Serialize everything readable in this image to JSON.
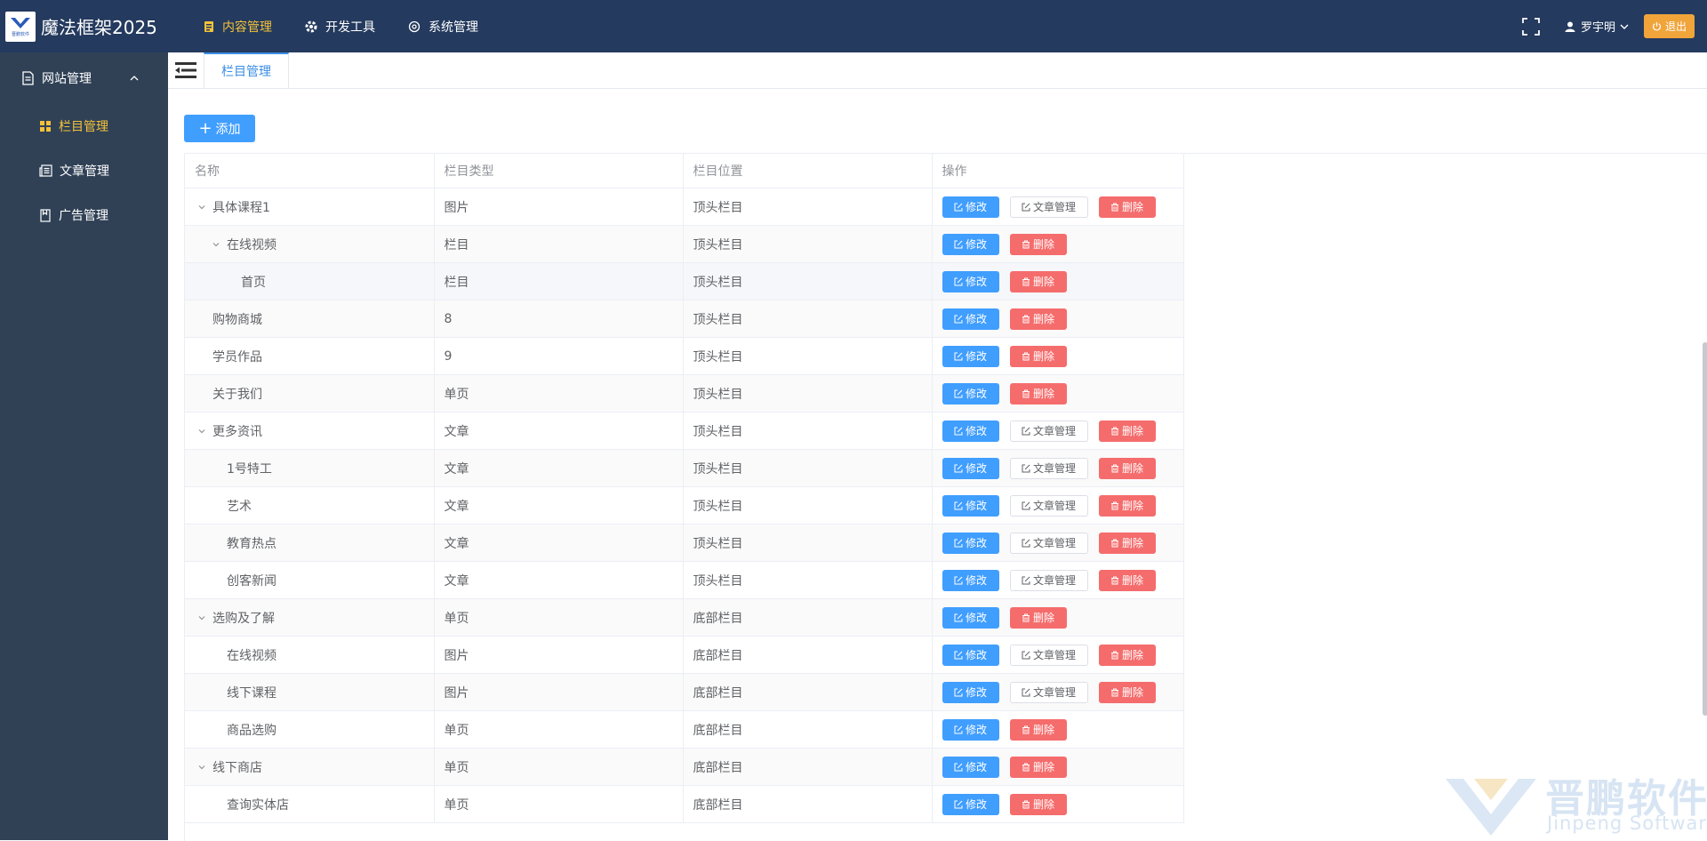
{
  "header": {
    "logo_text": "晋鹏软件",
    "title": "魔法框架2025",
    "nav": [
      {
        "label": "内容管理",
        "active": true
      },
      {
        "label": "开发工具",
        "active": false
      },
      {
        "label": "系统管理",
        "active": false
      }
    ],
    "user": "罗宇明",
    "logout": "退出"
  },
  "sidebar": {
    "group": "网站管理",
    "items": [
      {
        "label": "栏目管理",
        "active": true
      },
      {
        "label": "文章管理",
        "active": false
      },
      {
        "label": "广告管理",
        "active": false
      }
    ]
  },
  "tabs": [
    {
      "label": "栏目管理"
    }
  ],
  "main": {
    "add_button": "添加",
    "columns": [
      "名称",
      "栏目类型",
      "栏目位置",
      "操作"
    ],
    "buttons": {
      "edit": "修改",
      "article": "文章管理",
      "delete": "删除"
    },
    "rows": [
      {
        "name": "具体课程1",
        "type": "图片",
        "position": "顶头栏目",
        "level": 0,
        "expandable": true,
        "article": true
      },
      {
        "name": "在线视频",
        "type": "栏目",
        "position": "顶头栏目",
        "level": 1,
        "expandable": true,
        "article": false
      },
      {
        "name": "首页",
        "type": "栏目",
        "position": "顶头栏目",
        "level": 2,
        "expandable": false,
        "article": false
      },
      {
        "name": "购物商城",
        "type": "8",
        "position": "顶头栏目",
        "level": 0,
        "expandable": false,
        "article": false
      },
      {
        "name": "学员作品",
        "type": "9",
        "position": "顶头栏目",
        "level": 0,
        "expandable": false,
        "article": false
      },
      {
        "name": "关于我们",
        "type": "单页",
        "position": "顶头栏目",
        "level": 0,
        "expandable": false,
        "article": false
      },
      {
        "name": "更多资讯",
        "type": "文章",
        "position": "顶头栏目",
        "level": 0,
        "expandable": true,
        "article": true
      },
      {
        "name": "1号特工",
        "type": "文章",
        "position": "顶头栏目",
        "level": 1,
        "expandable": false,
        "article": true
      },
      {
        "name": "艺术",
        "type": "文章",
        "position": "顶头栏目",
        "level": 1,
        "expandable": false,
        "article": true
      },
      {
        "name": "教育热点",
        "type": "文章",
        "position": "顶头栏目",
        "level": 1,
        "expandable": false,
        "article": true
      },
      {
        "name": "创客新闻",
        "type": "文章",
        "position": "顶头栏目",
        "level": 1,
        "expandable": false,
        "article": true
      },
      {
        "name": "选购及了解",
        "type": "单页",
        "position": "底部栏目",
        "level": 0,
        "expandable": true,
        "article": false
      },
      {
        "name": "在线视频",
        "type": "图片",
        "position": "底部栏目",
        "level": 1,
        "expandable": false,
        "article": true
      },
      {
        "name": "线下课程",
        "type": "图片",
        "position": "底部栏目",
        "level": 1,
        "expandable": false,
        "article": true
      },
      {
        "name": "商品选购",
        "type": "单页",
        "position": "底部栏目",
        "level": 1,
        "expandable": false,
        "article": false
      },
      {
        "name": "线下商店",
        "type": "单页",
        "position": "底部栏目",
        "level": 0,
        "expandable": true,
        "article": false
      },
      {
        "name": "查询实体店",
        "type": "单页",
        "position": "底部栏目",
        "level": 1,
        "expandable": false,
        "article": false
      }
    ]
  },
  "watermark": {
    "title": "晋鹏软件",
    "subtitle": "Jinpeng Software"
  },
  "colors": {
    "header_bg": "#243a5e",
    "sidebar_bg": "#304156",
    "accent": "#f5c238",
    "primary": "#409eff",
    "danger": "#f56c6c",
    "warning": "#f0a43a"
  }
}
